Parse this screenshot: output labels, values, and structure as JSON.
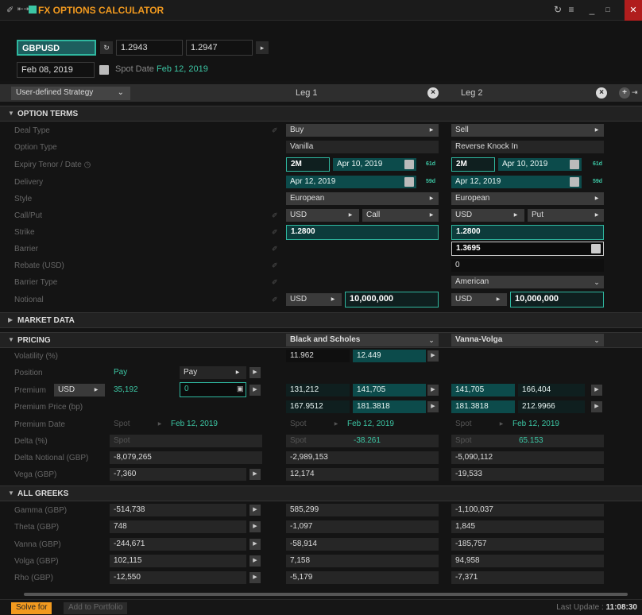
{
  "app": {
    "title": "FX OPTIONS CALCULATOR"
  },
  "top": {
    "ccy_pair": "GBPUSD",
    "bid": "1.2943",
    "ask": "1.2947",
    "trade_date": "Feb 08, 2019",
    "spot_date_label": "Spot Date",
    "spot_date": "Feb 12, 2019"
  },
  "legs_bar": {
    "strategy": "User-defined Strategy",
    "leg1": "Leg 1",
    "leg2": "Leg 2"
  },
  "sections": {
    "option_terms": "OPTION TERMS",
    "market_data": "MARKET DATA",
    "pricing": "PRICING",
    "all_greeks": "ALL GREEKS"
  },
  "labels": {
    "deal_type": "Deal Type",
    "option_type": "Option Type",
    "expiry": "Expiry Tenor / Date",
    "delivery": "Delivery",
    "style": "Style",
    "call_put": "Call/Put",
    "strike": "Strike",
    "barrier": "Barrier",
    "rebate": "Rebate (USD)",
    "barrier_type": "Barrier Type",
    "notional": "Notional",
    "volatility": "Volatility (%)",
    "position": "Position",
    "premium": "Premium",
    "premium_price": "Premium Price (bp)",
    "premium_date": "Premium Date",
    "delta": "Delta (%)",
    "delta_notional": "Delta Notional (GBP)",
    "vega": "Vega (GBP)",
    "gamma": "Gamma (GBP)",
    "theta": "Theta (GBP)",
    "vanna": "Vanna (GBP)",
    "volga": "Volga (GBP)",
    "rho": "Rho (GBP)"
  },
  "total": {
    "position_text": "Pay",
    "position_dd": "Pay",
    "premium_ccy": "USD",
    "premium": "35,192",
    "premium_input": "0",
    "spot": "Spot",
    "premium_date": "Feb 12, 2019",
    "delta_spot": "Spot",
    "delta_notional": "-8,079,265",
    "vega": "-7,360",
    "gamma": "-514,738",
    "theta": "748",
    "vanna": "-244,671",
    "volga": "102,115",
    "rho": "-12,550"
  },
  "leg1": {
    "deal_type": "Buy",
    "option_type": "Vanilla",
    "tenor": "2M",
    "expiry_date": "Apr 10, 2019",
    "expiry_days": "61d",
    "delivery": "Apr 12, 2019",
    "delivery_days": "59d",
    "style": "European",
    "ccy": "USD",
    "call_put": "Call",
    "strike": "1.2800",
    "notional_ccy": "USD",
    "notional": "10,000,000",
    "model": "Black and Scholes",
    "vol_a": "11.962",
    "vol_b": "12.449",
    "premium_a": "131,212",
    "premium_b": "141,705",
    "price_a": "167.9512",
    "price_b": "181.3818",
    "spot": "Spot",
    "premium_date": "Feb 12, 2019",
    "delta_spot": "Spot",
    "delta": "-38.261",
    "delta_notional": "-2,989,153",
    "vega": "12,174",
    "gamma": "585,299",
    "theta": "-1,097",
    "vanna": "-58,914",
    "volga": "7,158",
    "rho": "-5,179"
  },
  "leg2": {
    "deal_type": "Sell",
    "option_type": "Reverse Knock In",
    "tenor": "2M",
    "expiry_date": "Apr 10, 2019",
    "expiry_days": "61d",
    "delivery": "Apr 12, 2019",
    "delivery_days": "59d",
    "style": "European",
    "ccy": "USD",
    "call_put": "Put",
    "strike": "1.2800",
    "barrier": "1.3695",
    "rebate": "0",
    "barrier_type": "American",
    "notional_ccy": "USD",
    "notional": "10,000,000",
    "model": "Vanna-Volga",
    "premium_a": "141,705",
    "premium_b": "166,404",
    "price_a": "181.3818",
    "price_b": "212.9966",
    "spot": "Spot",
    "premium_date": "Feb 12, 2019",
    "delta_spot": "Spot",
    "delta": "65.153",
    "delta_notional": "-5,090,112",
    "vega": "-19,533",
    "gamma": "-1,100,037",
    "theta": "1,845",
    "vanna": "-185,757",
    "volga": "94,958",
    "rho": "-7,371"
  },
  "status": {
    "solve_for": "Solve for",
    "add_to_portfolio": "Add to Portfolio",
    "last_update_label": "Last Update :",
    "last_update": "11:08:30"
  },
  "colors": {
    "accent": "#f29a1f",
    "teal": "#2fb79f",
    "teal_fill": "#0c4b4b"
  }
}
